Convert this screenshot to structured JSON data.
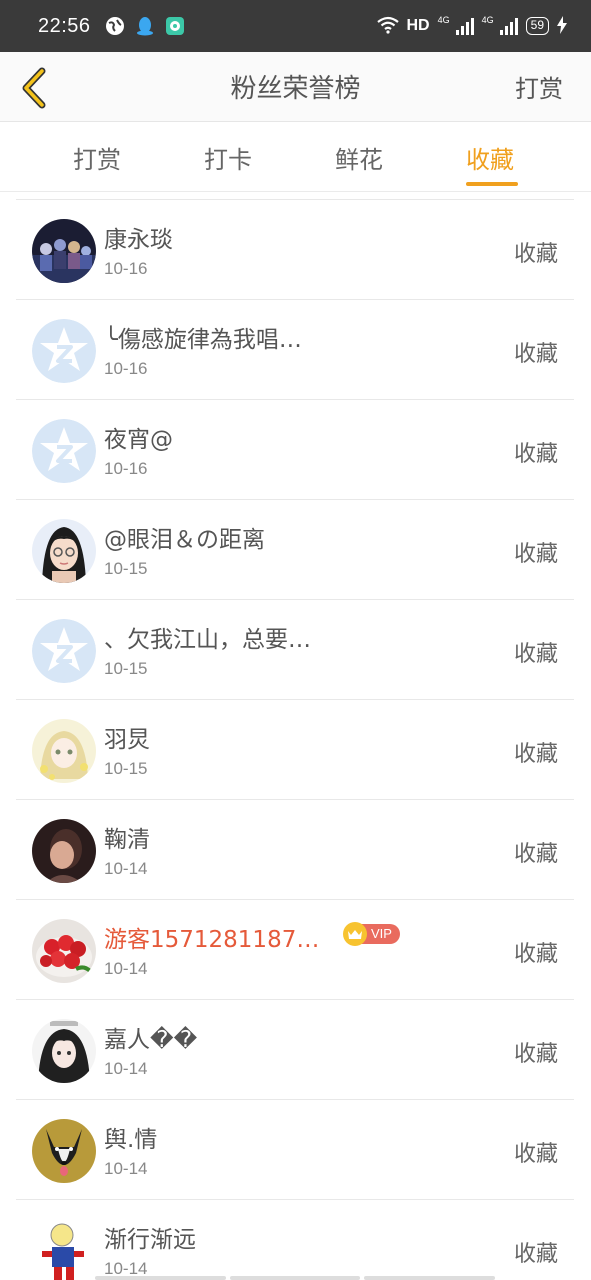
{
  "status_bar": {
    "time": "22:56",
    "hd_label": "HD",
    "network_1": "4G",
    "network_2": "4G",
    "battery": "59"
  },
  "header": {
    "title": "粉丝荣誉榜",
    "right_action": "打赏",
    "back_icon": "chevron-left-icon"
  },
  "tabs": [
    {
      "label": "打赏",
      "active": false
    },
    {
      "label": "打卡",
      "active": false
    },
    {
      "label": "鲜花",
      "active": false
    },
    {
      "label": "收藏",
      "active": true
    }
  ],
  "colors": {
    "accent": "#f0a01e",
    "vip_name": "#e55a3a",
    "vip_badge": "#e96b5e",
    "default_avatar": "#d7e6f6"
  },
  "list": [
    {
      "name": "康永琰",
      "date": "10-16",
      "action": "收藏",
      "avatar": "photo-game-art",
      "vip": false
    },
    {
      "name": "╰傷感旋律為我唱…",
      "date": "10-16",
      "action": "收藏",
      "avatar": "default-z-star",
      "vip": false
    },
    {
      "name": "夜宵@",
      "date": "10-16",
      "action": "收藏",
      "avatar": "default-z-star",
      "vip": false
    },
    {
      "name": "@眼泪＆の距离",
      "date": "10-15",
      "action": "收藏",
      "avatar": "cartoon-girl-glasses",
      "vip": false
    },
    {
      "name": "、欠我江山，总要…",
      "date": "10-15",
      "action": "收藏",
      "avatar": "default-z-star",
      "vip": false
    },
    {
      "name": "羽炅",
      "date": "10-15",
      "action": "收藏",
      "avatar": "anime-girl-yellow",
      "vip": false
    },
    {
      "name": "鞠清",
      "date": "10-14",
      "action": "收藏",
      "avatar": "photo-dark-person",
      "vip": false
    },
    {
      "name": "游客1571281187…",
      "date": "10-14",
      "action": "收藏",
      "avatar": "strawberries",
      "vip": true,
      "vip_label": "VIP"
    },
    {
      "name": "嘉人��",
      "date": "10-14",
      "action": "收藏",
      "avatar": "anime-girl-dark",
      "vip": false
    },
    {
      "name": "舆.情",
      "date": "10-14",
      "action": "收藏",
      "avatar": "husky-dog",
      "vip": false
    },
    {
      "name": "渐行渐远",
      "date": "10-14",
      "action": "收藏",
      "avatar": "cartoon-boy",
      "vip": false
    }
  ]
}
